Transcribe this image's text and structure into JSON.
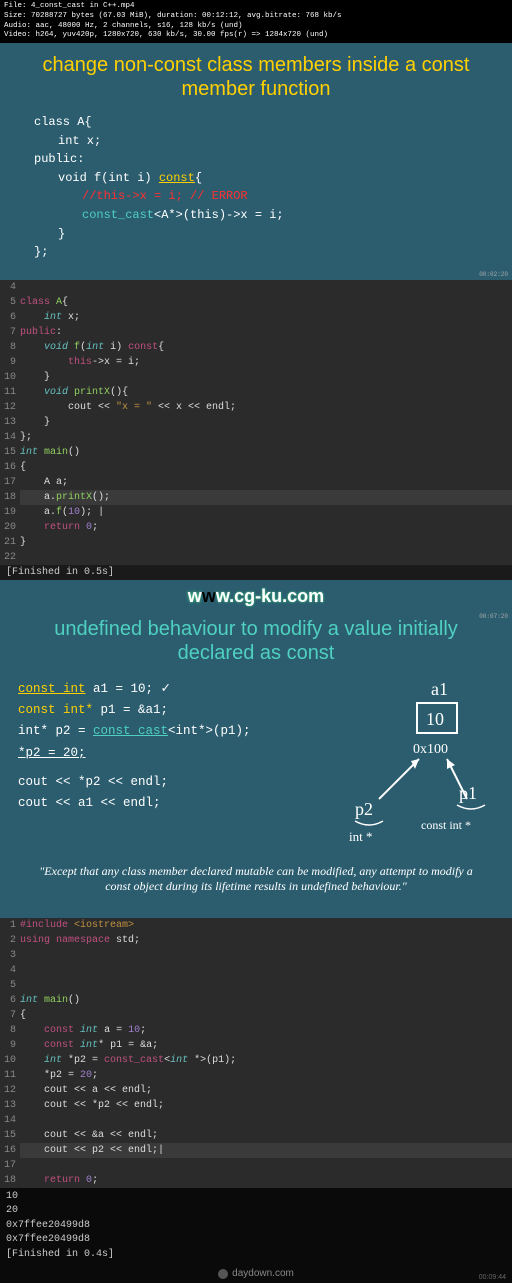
{
  "file_info": {
    "l1": "File: 4_const_cast in C++.mp4",
    "l2": "Size: 70288727 bytes (67.03 MiB), duration: 00:12:12, avg.bitrate: 768 kb/s",
    "l3": "Audio: aac, 48000 Hz, 2 channels, s16, 128 kb/s (und)",
    "l4": "Video: h264, yuv420p, 1280x720, 630 kb/s, 30.00 fps(r) => 1284x720 (und)"
  },
  "slide1": {
    "title": "change non-const class members inside a const member function",
    "ts": "00:02:20",
    "code": {
      "r1": "class A{",
      "r2": "int x;",
      "r3": "public:",
      "r4a": "void f(int i) ",
      "r4b": "const",
      "r4c": "{",
      "r5": "//this->x = i; // ERROR",
      "r6a": "const_cast",
      "r6b": "<A*>(this)->x = i;",
      "r7": "}",
      "r8": "};"
    }
  },
  "editor1": {
    "lines": [
      {
        "n": "4",
        "t": ""
      },
      {
        "n": "5",
        "t": "class A{",
        "cls": "e-kw"
      },
      {
        "n": "6",
        "t": "    int x;"
      },
      {
        "n": "7",
        "t": "public:"
      },
      {
        "n": "8",
        "t": "    void f(int i) const{"
      },
      {
        "n": "9",
        "t": "        this->x = i;"
      },
      {
        "n": "10",
        "t": "    }"
      },
      {
        "n": "11",
        "t": "    void printX(){"
      },
      {
        "n": "12",
        "t": "        cout << \"x = \" << x << endl;"
      },
      {
        "n": "13",
        "t": "    }"
      },
      {
        "n": "14",
        "t": "};"
      },
      {
        "n": "15",
        "t": "int main()"
      },
      {
        "n": "16",
        "t": "{"
      },
      {
        "n": "17",
        "t": "    A a;"
      },
      {
        "n": "18",
        "t": "    a.printX();",
        "hl": true
      },
      {
        "n": "19",
        "t": "    a.f(10); |"
      },
      {
        "n": "20",
        "t": "    return 0;"
      },
      {
        "n": "21",
        "t": "}"
      },
      {
        "n": "22",
        "t": ""
      }
    ],
    "finished": "[Finished in 0.5s]"
  },
  "watermark": "www.cg-ku.com",
  "slide2": {
    "title": "undefined behaviour to modify a value initially declared as const",
    "ts": "00:07:20",
    "code": {
      "l1a": "const int",
      "l1b": " a1 = 10;    ✓",
      "l2a": "const int*",
      "l2b": " p1 = &a1;",
      "l3a": "int* p2 = ",
      "l3b": "const_cast",
      "l3c": "<int*>(p1);",
      "l4": "*p2 = 20;",
      "l5": "cout << *p2 << endl;",
      "l6": "cout << a1 << endl;"
    },
    "draw": {
      "a1": "a1",
      "box": "10",
      "addr": "0x100",
      "p2": "p2",
      "p1": "p1",
      "t1": "int *",
      "t2": "const int *"
    },
    "quote": "\"Except that any class member declared mutable can be modified, any attempt to modify a const object during its lifetime results in undefined behaviour.\""
  },
  "editor2": {
    "lines": [
      {
        "n": "1",
        "t": "#include <iostream>"
      },
      {
        "n": "2",
        "t": "using namespace std;"
      },
      {
        "n": "3",
        "t": ""
      },
      {
        "n": "4",
        "t": ""
      },
      {
        "n": "5",
        "t": ""
      },
      {
        "n": "6",
        "t": "int main()"
      },
      {
        "n": "7",
        "t": "{"
      },
      {
        "n": "8",
        "t": "    const int a = 10;"
      },
      {
        "n": "9",
        "t": "    const int* p1 = &a;"
      },
      {
        "n": "10",
        "t": "    int *p2 = const_cast<int *>(p1);"
      },
      {
        "n": "11",
        "t": "    *p2 = 20;"
      },
      {
        "n": "12",
        "t": "    cout << a << endl;"
      },
      {
        "n": "13",
        "t": "    cout << *p2 << endl;"
      },
      {
        "n": "14",
        "t": ""
      },
      {
        "n": "15",
        "t": "    cout << &a << endl;"
      },
      {
        "n": "16",
        "t": "    cout << p2 << endl;|",
        "hl": true
      },
      {
        "n": "17",
        "t": ""
      },
      {
        "n": "18",
        "t": "    return 0;"
      }
    ]
  },
  "output": {
    "l1": "10",
    "l2": "20",
    "l3": "0x7ffee20499d8",
    "l4": "0x7ffee20499d8",
    "l5": "[Finished in 0.4s]"
  },
  "footer": "daydown.com",
  "ts2": "00:09:44"
}
